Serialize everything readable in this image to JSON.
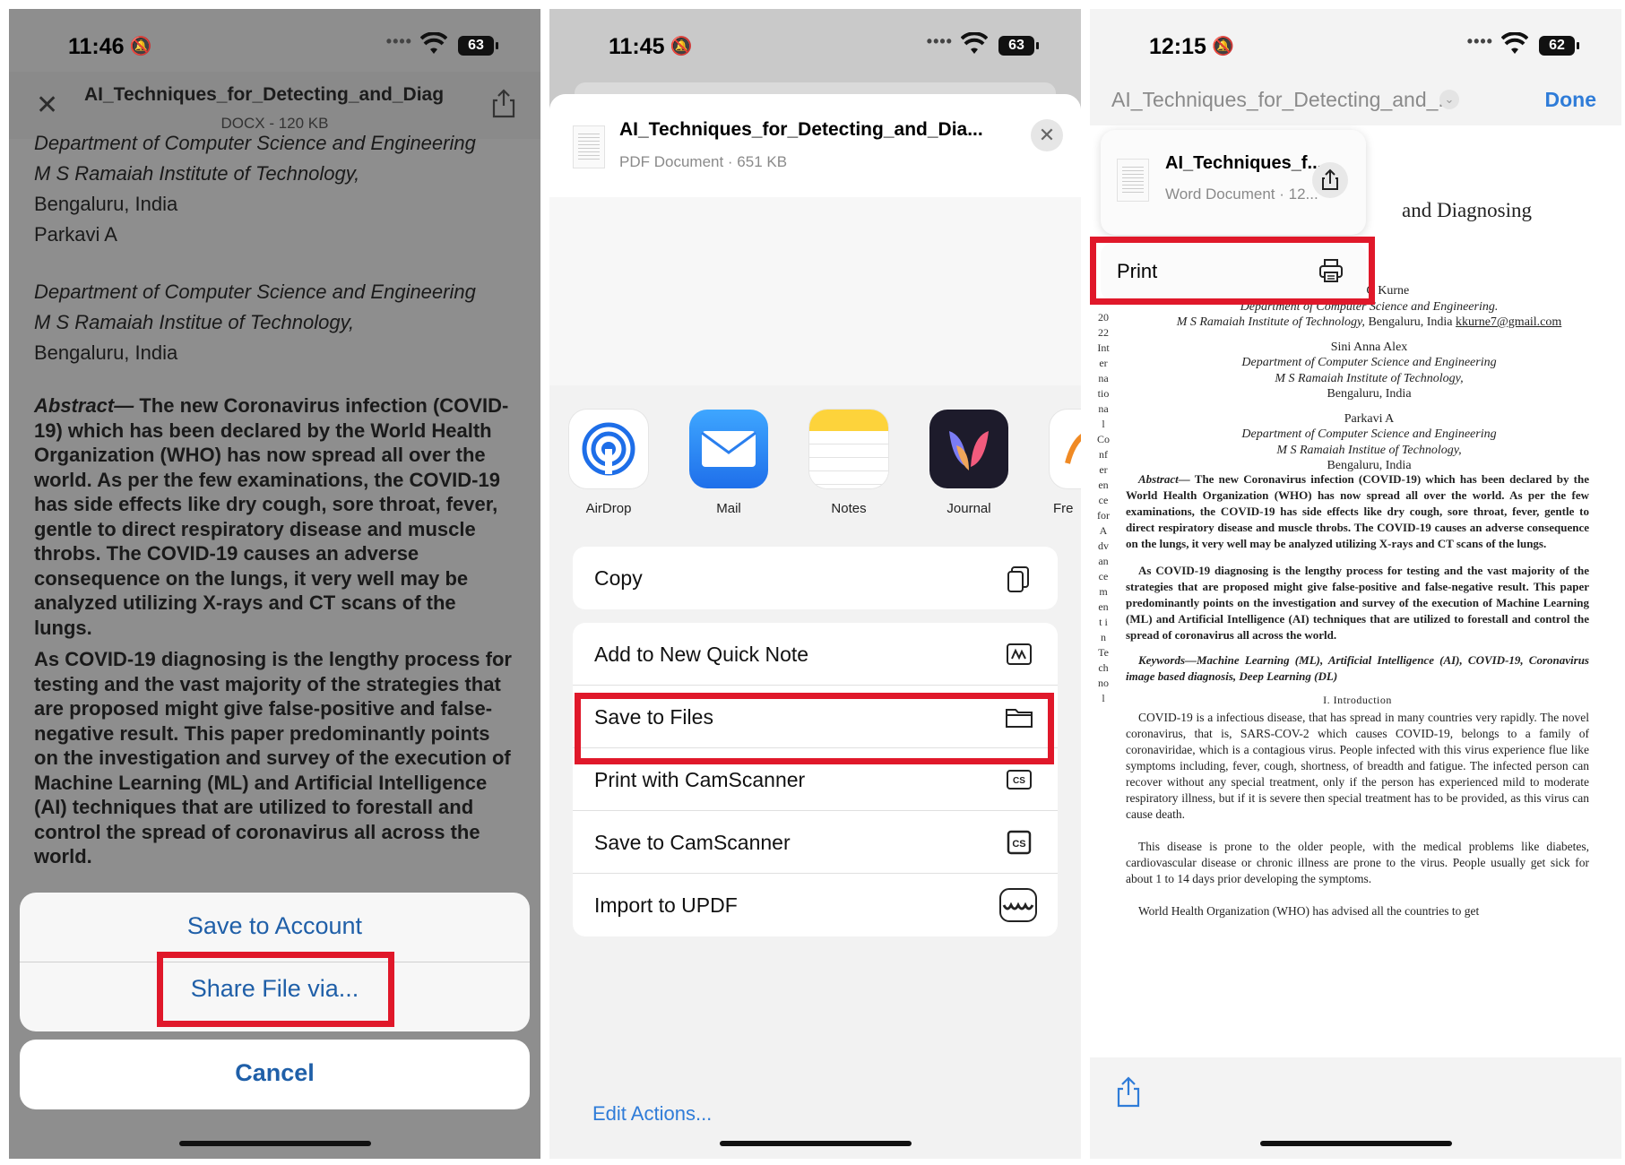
{
  "panel1": {
    "status": {
      "time": "11:46",
      "battery": "63"
    },
    "header": {
      "title": "AI_Techniques_for_Detecting_and_Diag...",
      "subtitle": "DOCX - 120 KB"
    },
    "body": {
      "aff1_dept": "Department of Computer Science and Engineering",
      "aff1_inst": "M S Ramaiah Institute of Technology,",
      "aff1_city": "Bengaluru, India",
      "author2": "Parkavi A",
      "aff2_dept": "Department of Computer Science and Engineering",
      "aff2_inst": "M S Ramaiah Institue of Technology,",
      "aff2_city": "Bengaluru, India",
      "abstract_label": "Abstract—",
      "abstract_text": " The new Coronavirus infection (COVID-19) which has been declared by the World Health Organization (WHO) has now spread all over the world. As per the few examinations, the COVID-19 has side effects like dry cough, sore throat, fever, gentle to direct respiratory disease and muscle throbs. The COVID-19 causes an adverse consequence on the lungs, it very well may be analyzed utilizing X-rays and CT scans of the lungs.",
      "para2": "As COVID-19 diagnosing is the lengthy process for testing and the vast majority of the strategies that are proposed might give false-positive and false-negative result. This paper predominantly points on the investigation and survey of the execution of Machine Learning (ML) and Artificial Intelligence (AI) techniques that are utilized to forestall and control the spread of coronavirus all across the world."
    },
    "sheet": {
      "save_account": "Save to Account",
      "share_file": "Share File via...",
      "cancel": "Cancel"
    }
  },
  "panel2": {
    "status": {
      "time": "11:45",
      "battery": "63"
    },
    "file": {
      "title": "AI_Techniques_for_Detecting_and_Dia...",
      "subtitle": "PDF Document · 651 KB"
    },
    "apps": [
      {
        "label": "AirDrop",
        "icon": "airdrop-icon"
      },
      {
        "label": "Mail",
        "icon": "mail-icon"
      },
      {
        "label": "Notes",
        "icon": "notes-icon"
      },
      {
        "label": "Journal",
        "icon": "journal-icon"
      },
      {
        "label": "Fre",
        "icon": "freeform-icon"
      }
    ],
    "copy": "Copy",
    "actions": [
      "Add to New Quick Note",
      "Save to Files",
      "Print with CamScanner",
      "Save to CamScanner",
      "Import to UPDF"
    ],
    "edit_actions": "Edit Actions..."
  },
  "panel3": {
    "status": {
      "time": "12:15",
      "battery": "62"
    },
    "nav": {
      "title": "AI_Techniques_for_Detecting_and_...",
      "done": "Done"
    },
    "menu": {
      "title": "AI_Techniques_f...",
      "subtitle": "Word Document · 12...",
      "print": "Print"
    },
    "doc": {
      "title_frag": "and Diagnosing",
      "author1_frag": "Kshitij C Kurne",
      "a1_dept": "Department of Computer Science and Engineering.",
      "a1_inst": "M S Ramaiah Institute of Technology,",
      "a1_city_email": " Bengaluru, India ",
      "a1_email": "kkurne7@gmail.com",
      "author2": "Sini Anna Alex",
      "a2_dept": "Department of Computer Science and Engineering",
      "a2_inst": "M S Ramaiah Institute of Technology,",
      "a2_city": "Bengaluru, India",
      "author3": "Parkavi A",
      "a3_dept": "Department of Computer Science and Engineering",
      "a3_inst": "M S Ramaiah Institue of Technology,",
      "a3_city": "Bengaluru, India",
      "vertical": "2022International Conference for Advancement in Technol",
      "abstract_label": "Abstract—",
      "abstract": " The new Coronavirus infection (COVID-19) which has been declared by the World Health Organization (WHO) has now spread all over the world. As per the few examinations, the COVID-19 has side effects like dry cough, sore throat, fever, gentle to direct respiratory disease and muscle throbs. The COVID-19 causes an adverse consequence on the lungs, it very well may be analyzed utilizing X-rays and CT scans of the lungs.",
      "para2": "As COVID-19 diagnosing is the lengthy process for testing and the vast majority of the strategies that are proposed might give false-positive and false-negative result. This paper predominantly points on the investigation and survey of the execution of Machine Learning (ML) and Artificial Intelligence (AI) techniques that are utilized to forestall and control the spread of coronavirus all across the world.",
      "keywords": "Keywords—Machine Learning (ML), Artificial Intelligence (AI), COVID-19, Coronavirus image based diagnosis, Deep Learning (DL)",
      "section": "I. Introduction",
      "intro1": "COVID-19 is a infectious disease, that has spread in many countries very rapidly. The novel coronavirus, that is, SARS-COV-2 which causes COVID-19, belongs to a family of coronaviridae, which is a contagious virus. People infected with this virus experience flue like symptoms including, fever, cough, shortness, of breadth and fatigue. The infected person can recover without any special treatment, only if the person has experienced mild to moderate respiratory illness, but if it is severe then special treatment has to be provided, as this virus can cause death.",
      "intro2": "This disease is prone to the older people, with the medical problems like diabetes, cardiovascular disease or chronic illness are prone to the virus. People usually get sick for about 1 to 14 days prior developing the symptoms.",
      "intro3": "World Health Organization (WHO) has advised all the countries to get"
    }
  },
  "colors": {
    "highlight": "#e0182a",
    "ios_blue": "#2f7cd8"
  }
}
